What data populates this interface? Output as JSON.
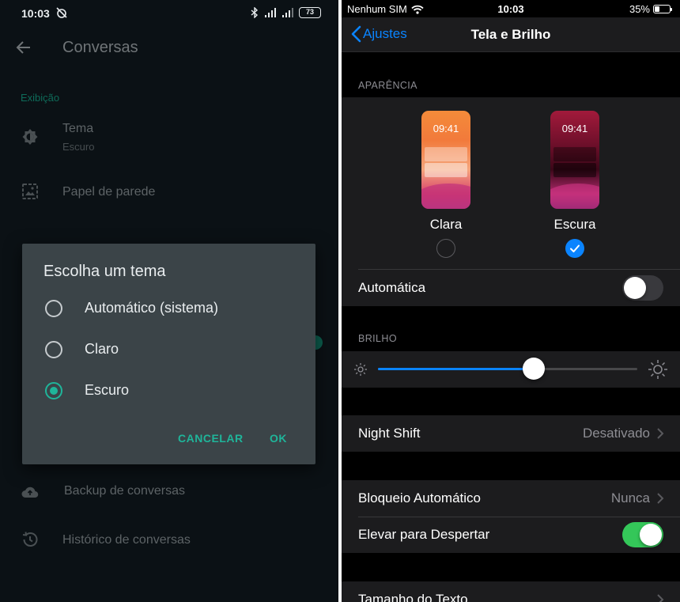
{
  "android": {
    "status": {
      "time": "10:03",
      "battery": "73"
    },
    "appbar": {
      "title": "Conversas"
    },
    "section": "Exibição",
    "rows": {
      "tema": {
        "title": "Tema",
        "subtitle": "Escuro"
      },
      "papel": {
        "title": "Papel de parede"
      },
      "backup": {
        "title": "Backup de conversas"
      },
      "historico": {
        "title": "Histórico de conversas"
      }
    },
    "dialog": {
      "title": "Escolha um tema",
      "options": [
        {
          "label": "Automático (sistema)",
          "selected": false
        },
        {
          "label": "Claro",
          "selected": false
        },
        {
          "label": "Escuro",
          "selected": true
        }
      ],
      "cancel": "CANCELAR",
      "ok": "OK"
    },
    "colors": {
      "accent": "#1fb59a",
      "background": "#0b1115",
      "dialog": "#3b4448"
    }
  },
  "ios": {
    "status": {
      "carrier": "Nenhum SIM",
      "time": "10:03",
      "battery": "35%"
    },
    "nav": {
      "back": "Ajustes",
      "title": "Tela e Brilho"
    },
    "appearance": {
      "header": "APARÊNCIA",
      "light": {
        "label": "Clara",
        "preview_time": "09:41",
        "selected": false
      },
      "dark": {
        "label": "Escura",
        "preview_time": "09:41",
        "selected": true
      },
      "automatic": {
        "label": "Automática",
        "on": false
      }
    },
    "brightness": {
      "header": "BRILHO",
      "level": 0.6
    },
    "night_shift": {
      "label": "Night Shift",
      "value": "Desativado"
    },
    "auto_lock": {
      "label": "Bloqueio Automático",
      "value": "Nunca"
    },
    "raise_to_wake": {
      "label": "Elevar para Despertar",
      "on": true
    },
    "text_size": {
      "label": "Tamanho do Texto"
    },
    "colors": {
      "accent": "#0a84ff",
      "toggle_on": "#34c759",
      "cell": "#1c1c1e"
    }
  }
}
